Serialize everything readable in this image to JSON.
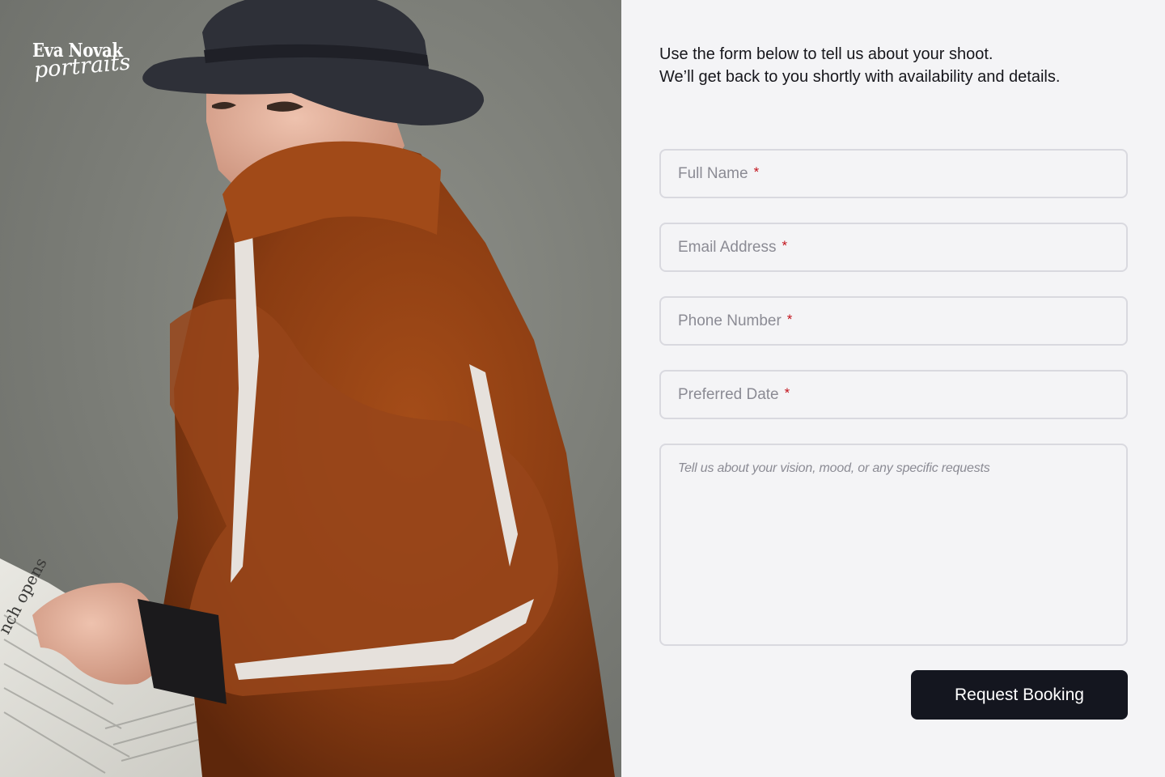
{
  "brand": {
    "name": "Eva Novak",
    "tagline": "portraits"
  },
  "intro": {
    "line1": "Use the form below to tell us about your shoot.",
    "line2": "We’ll get back to you shortly with availability and details."
  },
  "form": {
    "full_name": {
      "placeholder": "Full Name",
      "required_mark": "*"
    },
    "email": {
      "placeholder": "Email Address",
      "required_mark": "*"
    },
    "phone": {
      "placeholder": "Phone Number",
      "required_mark": "*"
    },
    "date": {
      "placeholder": "Preferred Date",
      "required_mark": "*"
    },
    "message": {
      "placeholder": "Tell us about your vision, mood, or any specific requests"
    },
    "submit_label": "Request Booking"
  },
  "photo": {
    "newspaper_text": "nch opens"
  },
  "colors": {
    "background": "#f4f4f6",
    "text": "#17171c",
    "placeholder": "#8b8b94",
    "required": "#c2121b",
    "button": "#14161f",
    "border": "#d9d9df"
  }
}
